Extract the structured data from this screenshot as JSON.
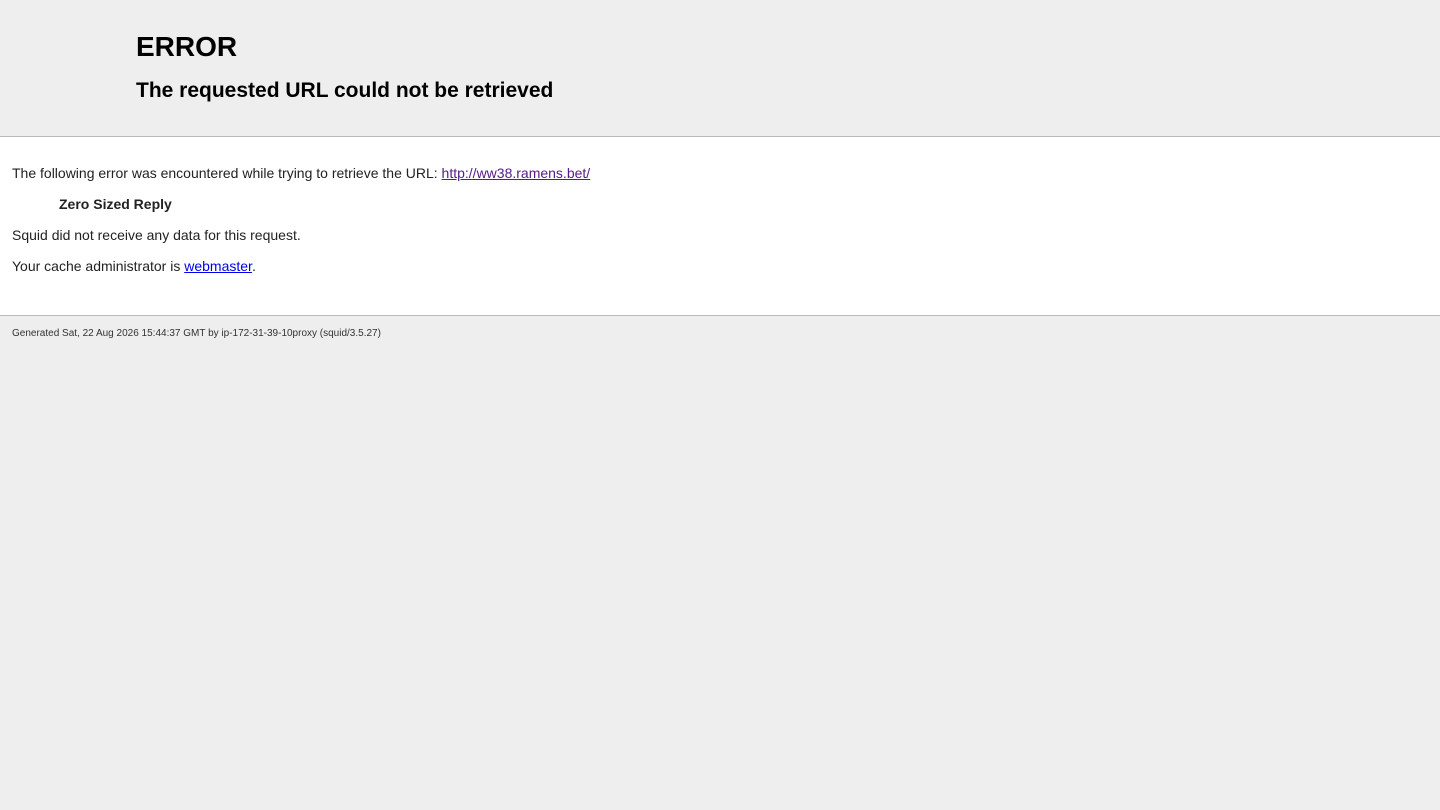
{
  "header": {
    "title": "ERROR",
    "subtitle": "The requested URL could not be retrieved"
  },
  "content": {
    "intro_text": "The following error was encountered while trying to retrieve the URL: ",
    "url": "http://ww38.ramens.bet/",
    "error_name": "Zero Sized Reply",
    "description": "Squid did not receive any data for this request.",
    "admin_text": "Your cache administrator is ",
    "admin_link": "webmaster",
    "admin_suffix": "."
  },
  "footer": {
    "generated": "Generated Sat, 22 Aug 2026 15:44:37 GMT by ip-172-31-39-10proxy (squid/3.5.27)"
  },
  "colors": {
    "page_background": "#eeeeee",
    "content_background": "#ffffff",
    "visited_link": "#551a8b",
    "link": "#0000ee"
  }
}
